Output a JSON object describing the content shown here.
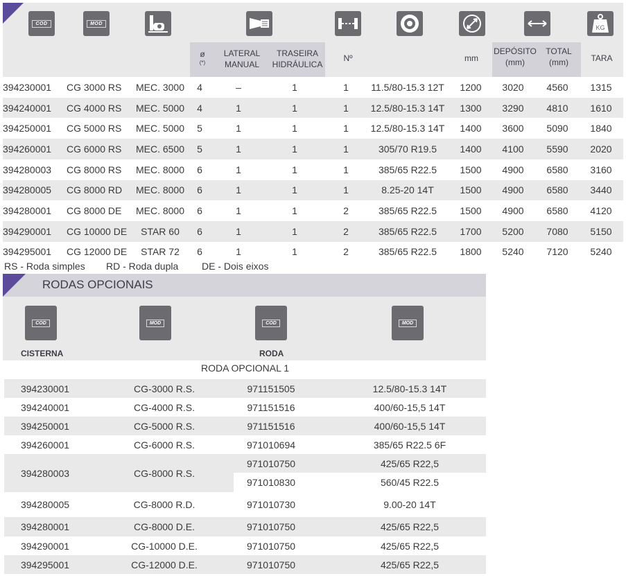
{
  "colors": {
    "accent": "#5c4a9a",
    "header_bg": "#e9e9ea",
    "highlight_bg": "#d2d2d8",
    "icon_bg": "#6b6b70"
  },
  "top_icons": [
    "cod-badge-icon",
    "mod-badge-icon",
    "pump-icon",
    "hydraulic-lift-icon",
    "axle-icon",
    "tyre-icon",
    "diameter-icon",
    "length-icon",
    "weight-kg-icon"
  ],
  "badges": {
    "cod": "COD",
    "mod": "MOD",
    "kg": "KG"
  },
  "top_headers": {
    "phi": "ø",
    "phi_note": "(*)",
    "lateral": [
      "LATERAL",
      "MANUAL"
    ],
    "traseira": [
      "TRASEIRA",
      "HIDRÁULICA"
    ],
    "no": "Nº",
    "mm": "mm",
    "deposito": [
      "DEPÓSITO",
      "(mm)"
    ],
    "total": [
      "TOTAL",
      "(mm)"
    ],
    "tara": "TARA"
  },
  "top_rows": [
    [
      "394230001",
      "CG 3000 RS",
      "MEC. 3000",
      "4",
      "–",
      "1",
      "1",
      "11.5/80-15.3 12T",
      "1200",
      "3020",
      "4560",
      "1315"
    ],
    [
      "394240001",
      "CG 4000 RS",
      "MEC. 5000",
      "4",
      "1",
      "1",
      "1",
      "12.5/80-15.3 14T",
      "1300",
      "3290",
      "4810",
      "1610"
    ],
    [
      "394250001",
      "CG 5000 RS",
      "MEC. 5000",
      "5",
      "1",
      "1",
      "1",
      "12.5/80-15.3 14T",
      "1400",
      "3600",
      "5090",
      "1840"
    ],
    [
      "394260001",
      "CG 6000 RS",
      "MEC. 6500",
      "5",
      "1",
      "1",
      "1",
      "305/70 R19.5",
      "1400",
      "4100",
      "5590",
      "2020"
    ],
    [
      "394280003",
      "CG 8000 RS",
      "MEC. 8000",
      "6",
      "1",
      "1",
      "1",
      "385/65 R22.5",
      "1500",
      "4900",
      "6580",
      "3160"
    ],
    [
      "394280005",
      "CG 8000 RD",
      "MEC. 8000",
      "6",
      "1",
      "1",
      "1",
      "8.25-20 14T",
      "1500",
      "4900",
      "6580",
      "3440"
    ],
    [
      "394280001",
      "CG 8000 DE",
      "MEC. 8000",
      "6",
      "1",
      "1",
      "2",
      "385/65 R22.5",
      "1500",
      "4900",
      "6580",
      "4120"
    ],
    [
      "394290001",
      "CG 10000 DE",
      "STAR 60",
      "6",
      "1",
      "1",
      "2",
      "385/65 R22.5",
      "1700",
      "5200",
      "7080",
      "5150"
    ],
    [
      "394295001",
      "CG 12000 DE",
      "STAR 72",
      "6",
      "1",
      "1",
      "2",
      "385/65 R22.5",
      "1800",
      "5240",
      "7120",
      "5240"
    ]
  ],
  "legend": [
    "RS - Roda simples",
    "RD - Roda dupla",
    "DE - Dois eixos"
  ],
  "optional": {
    "title": "RODAS OPCIONAIS",
    "labels": {
      "cisterna": "CISTERNA",
      "roda": "RODA"
    },
    "subtitle": "RODA OPCIONAL 1",
    "rows": [
      {
        "cod": "394230001",
        "model": "CG-3000 R.S.",
        "wheels": [
          [
            "971151505",
            "12.5/80-15.3  14T"
          ]
        ]
      },
      {
        "cod": "394240001",
        "model": "CG-4000 R.S.",
        "wheels": [
          [
            "971151516",
            "400/60-15,5  14T"
          ]
        ]
      },
      {
        "cod": "394250001",
        "model": "CG-5000 R.S.",
        "wheels": [
          [
            "971151516",
            "400/60-15,5  14T"
          ]
        ]
      },
      {
        "cod": "394260001",
        "model": "CG-6000 R.S.",
        "wheels": [
          [
            "971010694",
            "385/65 R22.5 6F"
          ]
        ]
      },
      {
        "cod": "394280003",
        "model": "CG-8000 R.S.",
        "wheels": [
          [
            "971010750",
            "425/65 R22,5"
          ],
          [
            "971010830",
            "560/45 R22.5"
          ]
        ]
      },
      {
        "cod": "394280005",
        "model": "CG-8000 R.D.",
        "wheels": [
          [
            "971010730",
            "9.00-20 14T"
          ]
        ]
      },
      {
        "cod": "394280001",
        "model": "CG-8000 D.E.",
        "wheels": [
          [
            "971010750",
            "425/65 R22,5"
          ]
        ]
      },
      {
        "cod": "394290001",
        "model": "CG-10000 D.E.",
        "wheels": [
          [
            "971010750",
            "425/65 R22,5"
          ]
        ]
      },
      {
        "cod": "394295001",
        "model": "CG-12000 D.E.",
        "wheels": [
          [
            "971010750",
            "425/65 R22,5"
          ]
        ]
      }
    ]
  }
}
